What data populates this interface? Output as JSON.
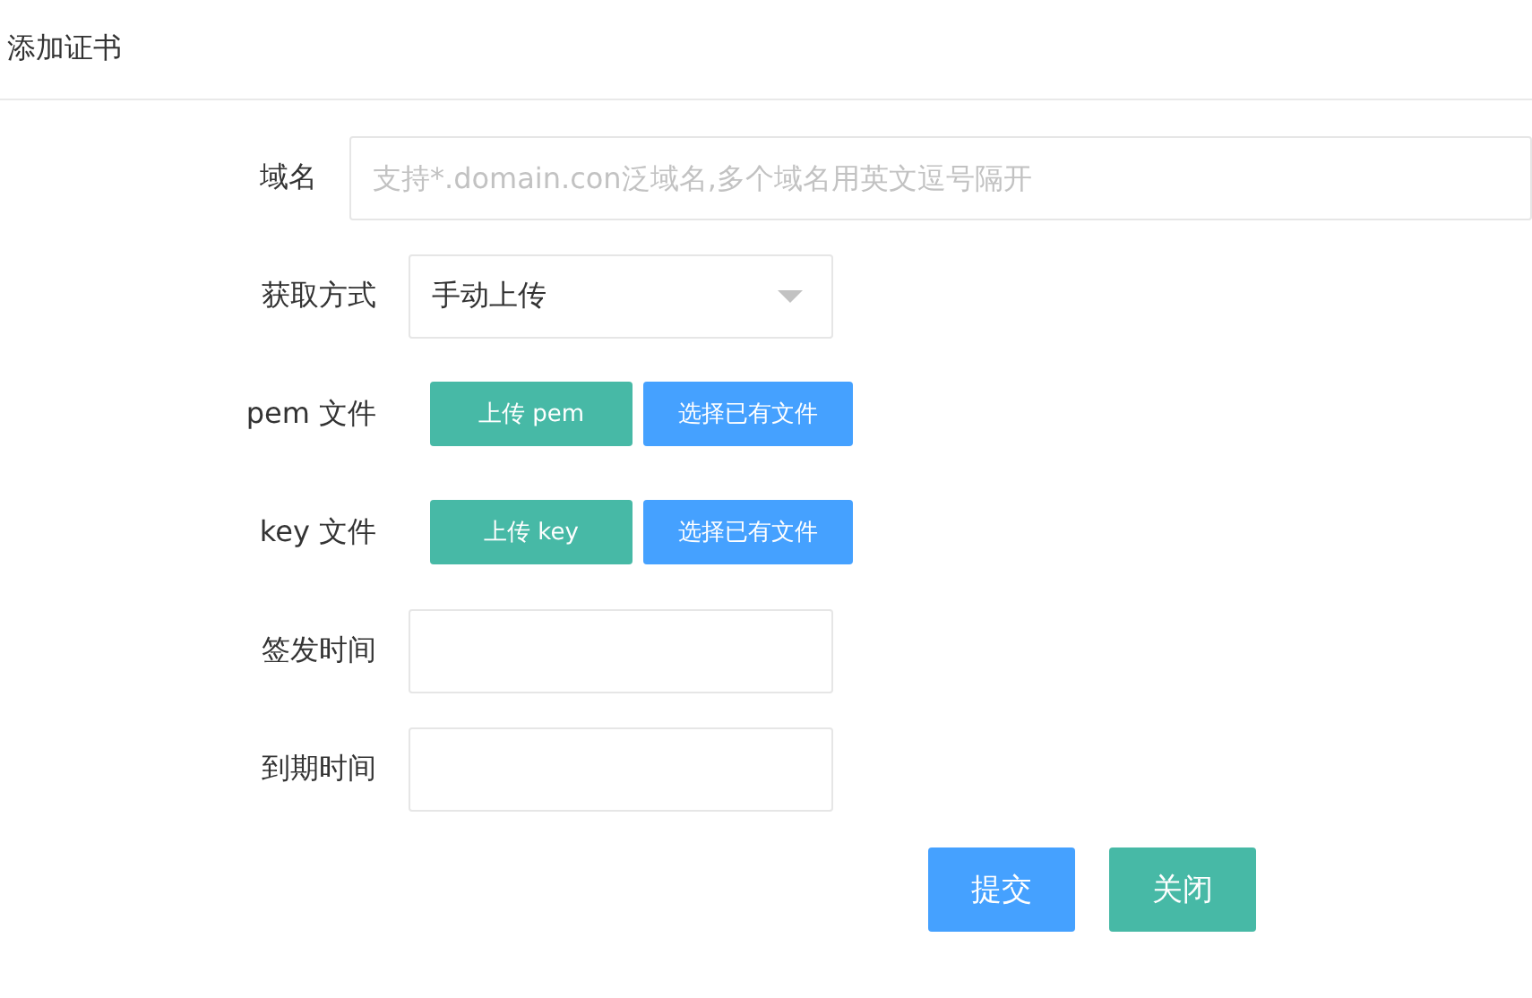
{
  "dialog": {
    "title": "添加证书"
  },
  "fields": [
    {
      "kind": "text",
      "label": "域名",
      "placeholder": "支持*.domain.con泛域名,多个域名用英文逗号隔开"
    },
    {
      "kind": "select",
      "label": "获取方式",
      "value": "手动上传"
    },
    {
      "kind": "upload",
      "label": "pem 文件",
      "buttons": [
        "上传 pem",
        "选择已有文件"
      ]
    },
    {
      "kind": "upload",
      "label": "key 文件",
      "buttons": [
        "上传 key",
        "选择已有文件"
      ]
    },
    {
      "kind": "date",
      "label": "签发时间"
    },
    {
      "kind": "date",
      "label": "到期时间"
    }
  ],
  "actions": [
    {
      "label": "提交",
      "kind": "primary"
    },
    {
      "label": "关闭",
      "kind": "secondary"
    }
  ]
}
